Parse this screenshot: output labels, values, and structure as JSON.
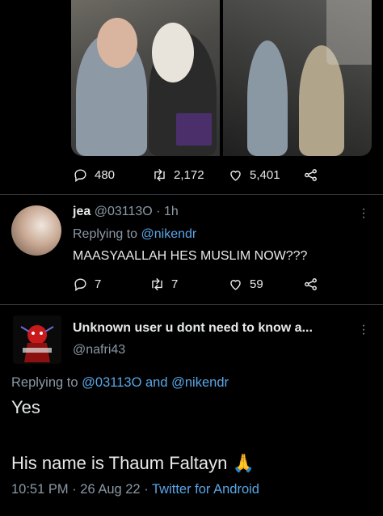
{
  "original_tweet": {
    "stats": {
      "replies": "480",
      "retweets": "2,172",
      "likes": "5,401"
    }
  },
  "reply": {
    "name": "jea",
    "handle": "@03113O",
    "time": "· 1h",
    "replying_prefix": "Replying to",
    "replying_to": "@nikendr",
    "text": "MAASYAALLAH HES MUSLIM NOW???",
    "stats": {
      "replies": "7",
      "retweets": "7",
      "likes": "59"
    }
  },
  "main_tweet": {
    "name": "Unknown user u dont need to know a...",
    "handle": "@nafri43",
    "replying_prefix": "Replying to",
    "replying_to_1": "@03113O",
    "replying_and": "and",
    "replying_to_2": "@nikendr",
    "text_line1": "Yes",
    "text_line2": "His name is Thaum Faltayn",
    "emoji": "🙏",
    "timestamp": "10:51 PM · 26 Aug 22 ·",
    "source": "Twitter for Android"
  },
  "icons": {
    "reply": "reply-bubble-icon",
    "retweet": "retweet-icon",
    "like": "heart-icon",
    "share": "share-icon",
    "more": "more-vertical-icon"
  },
  "colors": {
    "background": "#000000",
    "text": "#e7e9ea",
    "muted": "#8b98a5",
    "link": "#5aa6e6"
  }
}
